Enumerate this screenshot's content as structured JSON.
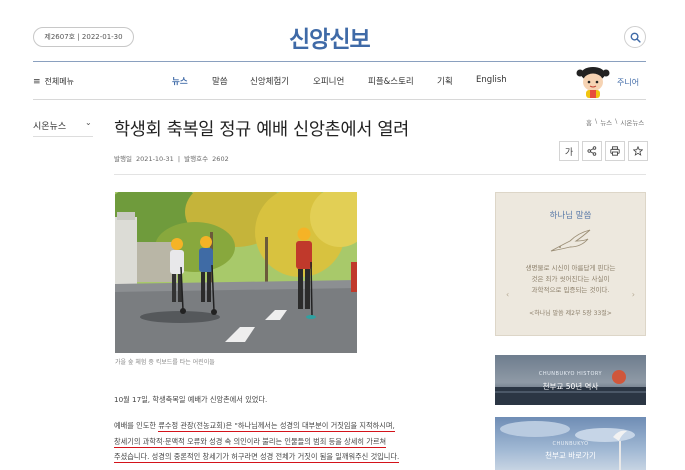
{
  "header": {
    "issue": "제2607호 | 2022-01-30",
    "logo": "신앙신보"
  },
  "nav": {
    "all_menu": "전체메뉴",
    "items": [
      "뉴스",
      "말씀",
      "신앙체험기",
      "오피니언",
      "피플&스토리",
      "기획",
      "English"
    ],
    "junior": "주니어"
  },
  "sidebar": {
    "title": "시온뉴스"
  },
  "article": {
    "title": "학생회 축복일 정규 예배 신앙촌에서 열려",
    "breadcrumb": [
      "홈",
      "뉴스",
      "시온뉴스"
    ],
    "meta_date_label": "발행일",
    "meta_date": "2021-10-31",
    "meta_issue_label": "발행호수",
    "meta_issue": "2602",
    "font_tool": "가",
    "photo_caption": "가을 숲 체험 중 킥보드를 타는 어린이들",
    "paragraph1": "10월 17일, 학생축복일 예배가 신앙촌에서 있었다.",
    "line2_pre": "예배를 인도한 ",
    "line2_hl": "류수정 관장(전농교회)은 \"하나님께서는 성경의 대부분이 거짓임을 지적하시며,",
    "line3_hl": "창세기의 과학적·문맥적 오류와 성경 속 의인이라 불리는 인물들의 범죄 등을 상세히 가르쳐",
    "line4_hl": "주셨습니다. 성경의 중론적인 창세기가 허구라면 성경 전체가 거짓이 됨을 일깨워주신 것입니다."
  },
  "verse_card": {
    "heading": "하나님 말씀",
    "lines": [
      "생명물로 시신이 아름답게 핀다는",
      "것은 죄가 씻어진다는 사실이",
      "과학적으로 입증되는 것이다."
    ],
    "reference": "<하나님 말씀 제2부 5장 33절>"
  },
  "banners": [
    {
      "sub": "CHUNBUKYO HISTORY",
      "title": "천부교 50년 역사"
    },
    {
      "sub": "CHUNBUKYO",
      "title": "천부교 바로가기"
    }
  ],
  "colors": {
    "brand": "#3f6aa7",
    "highlight": "#d3131a",
    "card_bg": "#ede8de"
  }
}
